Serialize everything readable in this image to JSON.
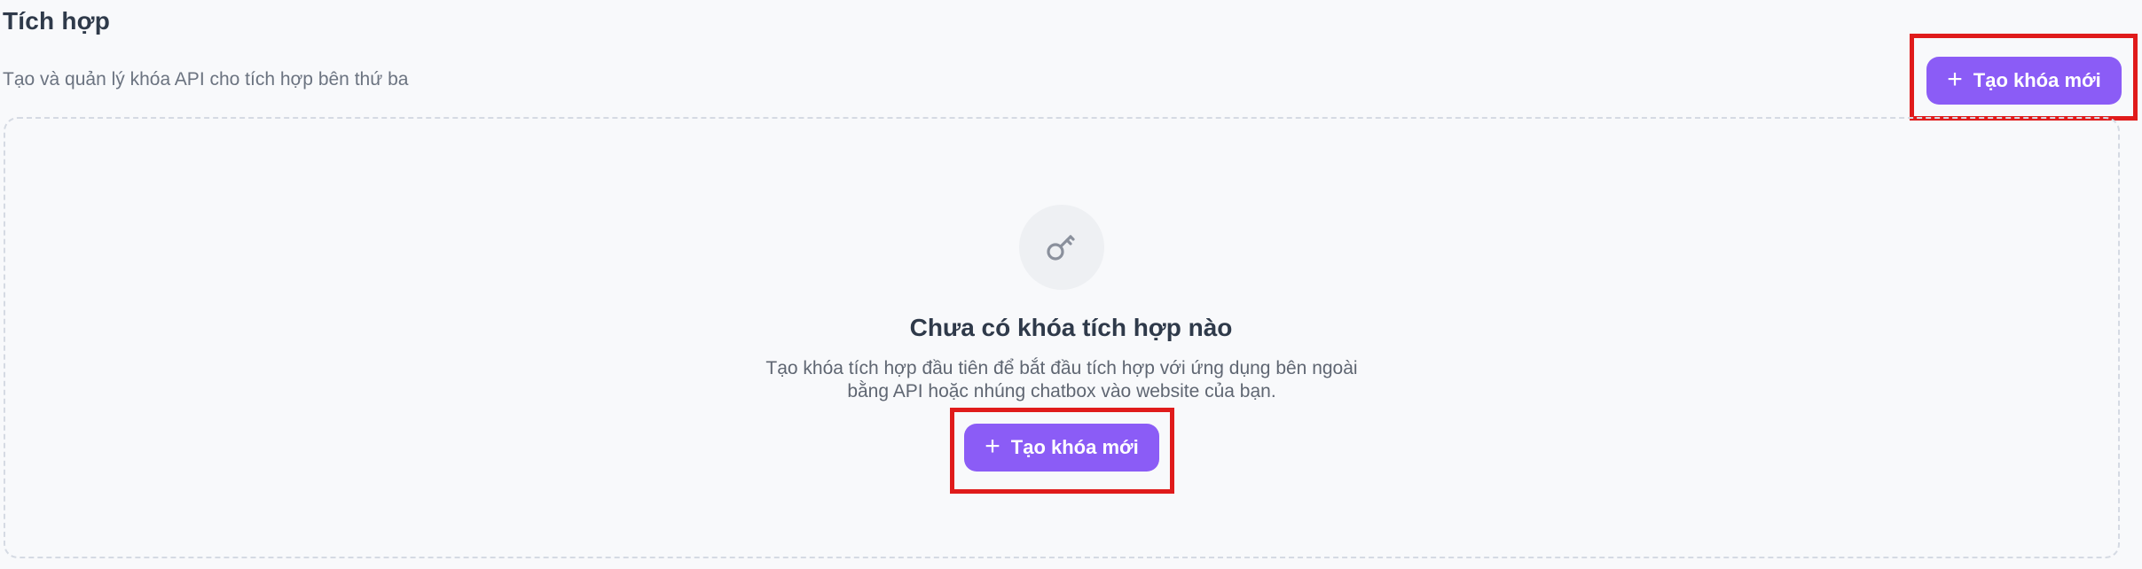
{
  "header": {
    "title": "Tích hợp",
    "subtitle": "Tạo và quản lý khóa API cho tích hợp bên thứ ba",
    "create_button_label": "Tạo khóa mới"
  },
  "empty_state": {
    "icon": "key-icon",
    "title": "Chưa có khóa tích hợp nào",
    "description": "Tạo khóa tích hợp đầu tiên để bắt đầu tích hợp với ứng dụng bên ngoài bằng API hoặc nhúng chatbox vào website của bạn.",
    "create_button_label": "Tạo khóa mới"
  },
  "colors": {
    "accent": "#8b5cf6",
    "highlight": "#e01b1b",
    "background": "#f8f9fb"
  }
}
